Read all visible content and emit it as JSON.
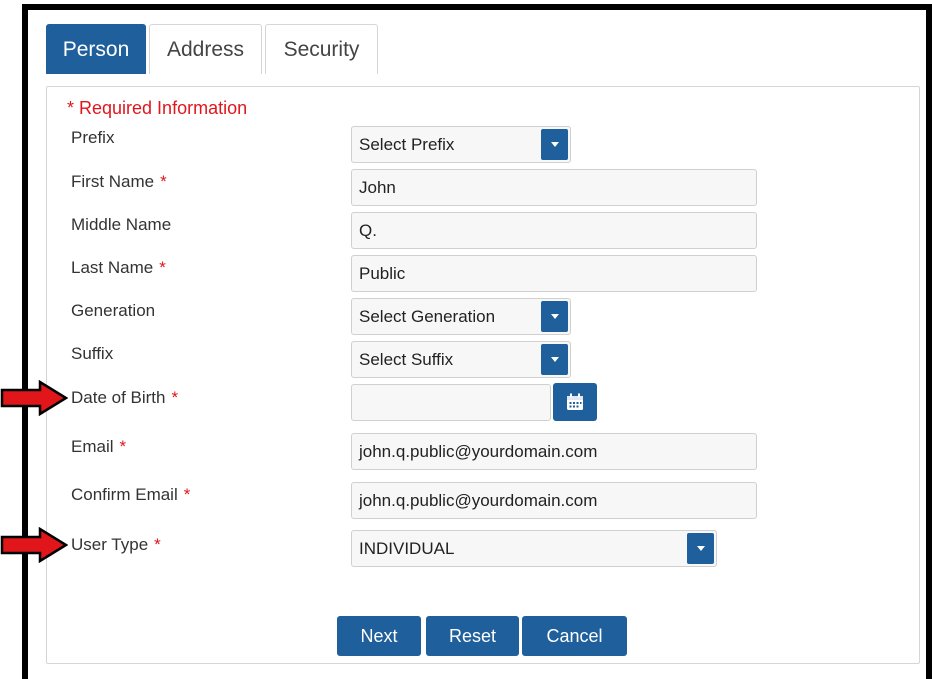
{
  "tabs": [
    {
      "label": "Person",
      "active": true
    },
    {
      "label": "Address",
      "active": false
    },
    {
      "label": "Security",
      "active": false
    }
  ],
  "required_note": "* Required Information",
  "required_marker": "*",
  "fields": {
    "prefix": {
      "label": "Prefix",
      "value": "Select Prefix"
    },
    "first_name": {
      "label": "First Name",
      "value": "John"
    },
    "middle_name": {
      "label": "Middle Name",
      "value": "Q."
    },
    "last_name": {
      "label": "Last Name",
      "value": "Public"
    },
    "generation": {
      "label": "Generation",
      "value": "Select Generation"
    },
    "suffix": {
      "label": "Suffix",
      "value": "Select Suffix"
    },
    "date_of_birth": {
      "label": "Date of Birth",
      "value": ""
    },
    "email": {
      "label": "Email",
      "value": "john.q.public@yourdomain.com"
    },
    "confirm_email": {
      "label": "Confirm Email",
      "value": "john.q.public@yourdomain.com"
    },
    "user_type": {
      "label": "User Type",
      "value": "INDIVIDUAL"
    }
  },
  "buttons": {
    "next": "Next",
    "reset": "Reset",
    "cancel": "Cancel"
  },
  "colors": {
    "accent": "#1f5f9b",
    "required": "#e0161b",
    "arrow": "#e0161b"
  },
  "icons": [
    "calendar-icon",
    "chevron-down-icon",
    "red-arrow-icon"
  ]
}
